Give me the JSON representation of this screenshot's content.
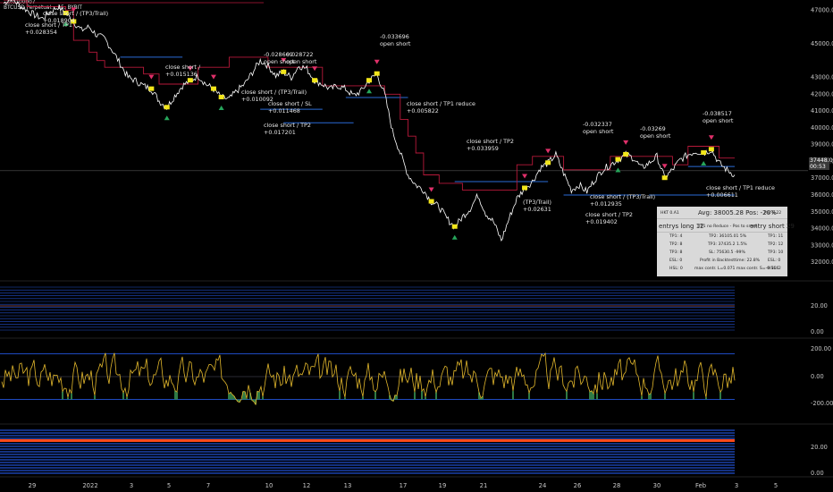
{
  "header": {
    "symbol": "BTCUSD Perpetual...",
    "interval": "15, BYBIT",
    "first_value": "-0.0100007"
  },
  "colors": {
    "background": "#000000",
    "price_line": "#ffffff",
    "stop_line": "#b7193a",
    "tp_line": "#2a6bd6",
    "buy_marker": "#26a65b",
    "sell_marker": "#e0306a",
    "fill_dot": "#f2e61a",
    "osc_line": "#e3b82c",
    "osc_fill": "#2f7a45",
    "band_blue": "#2962ff"
  },
  "price_axis": {
    "labels": [
      "47000.0",
      "45000.0",
      "43000.0",
      "42000.0",
      "41000.0",
      "40000.0",
      "39000.0",
      "38000.0",
      "37000.0",
      "36000.0",
      "35000.0",
      "34000.0",
      "33000.0",
      "32000.0"
    ],
    "current_price": "37448.0",
    "current_time": "00:53"
  },
  "panel2_axis": [
    "20.00",
    "0.00"
  ],
  "panel3_axis": [
    "200.00",
    "0.00",
    "-200.00"
  ],
  "panel4_axis": [
    "20.00",
    "0.00"
  ],
  "time_axis": [
    "29",
    "2022",
    "3",
    "5",
    "7",
    "10",
    "12",
    "13",
    "17",
    "19",
    "21",
    "24",
    "26",
    "28",
    "30",
    "Feb",
    "3",
    "5"
  ],
  "annotations": [
    {
      "lines": [
        "close short / (TP3/Trail)",
        "+0.018904"
      ]
    },
    {
      "lines": [
        "close short / TP1",
        "+0.028354"
      ]
    },
    {
      "lines": [
        "close short /",
        "+0.015136"
      ]
    },
    {
      "lines": [
        "-0.028669",
        "open short"
      ]
    },
    {
      "lines": [
        "0.028722",
        "open short"
      ]
    },
    {
      "lines": [
        "close short / (TP3/Trail)",
        "+0.010092"
      ]
    },
    {
      "lines": [
        "close short / SL",
        "+0.011468"
      ]
    },
    {
      "lines": [
        "close short / TP2",
        "+0.017201"
      ]
    },
    {
      "lines": [
        "-0.033696",
        "open short"
      ]
    },
    {
      "lines": [
        "close short / TP1 reduce",
        "+0.005822"
      ]
    },
    {
      "lines": [
        "close short / TP2",
        "+0.033959"
      ]
    },
    {
      "lines": [
        "(TP3/Trail)",
        "+0.02631"
      ]
    },
    {
      "lines": [
        "-0.032337",
        "open short"
      ]
    },
    {
      "lines": [
        "close short / (TP3/Trail)",
        "+0.012935"
      ]
    },
    {
      "lines": [
        "close short / TP2",
        "+0.019402"
      ]
    },
    {
      "lines": [
        "-0.03269",
        "open short"
      ]
    },
    {
      "lines": [
        "-0.038517",
        "open short"
      ]
    },
    {
      "lines": [
        "close short / TP1 reduce",
        "+0.006611"
      ]
    }
  ],
  "stats": {
    "hk_label": "HKT 0.A1",
    "avg_pos": "Avg: 38005.28 Pos: -20%",
    "pl": "P.V. 8.22",
    "entries_long": "entrys long 12",
    "tp1_reduce": "TP1 no Reduce - Pos to small",
    "entries_short": "entry short 29",
    "tp1_long": "TP1: 4",
    "tp2_mid": "TP2: 36105.01 5%",
    "tp1_short": "TP1: 11",
    "tp2_long": "TP2: 8",
    "tp3_mid": "TP3: 37435.2 1.5%",
    "tp2_short": "TP2: 12",
    "tp3_long": "TP3: 8",
    "sl_mid": "SL: 75630.5 -99%",
    "tp3_short": "TP3: 10",
    "esl_long": "ESL: 0",
    "profit_mid": "Profit in Backtesttime: 22.8%",
    "esl_short": "ESL: 0",
    "hsl_long": "HSL: 0",
    "max_contr": "max contr. L=0.071 max contr. S=-0.166",
    "hsl_short": "HSL: 2"
  },
  "chart_data": {
    "type": "line",
    "title": "",
    "xlabel": "",
    "ylabel": "",
    "x_ticks": [
      "29",
      "2022",
      "3",
      "5",
      "7",
      "10",
      "12",
      "13",
      "17",
      "19",
      "21",
      "24",
      "26",
      "28",
      "30",
      "Feb",
      "3",
      "5"
    ],
    "ylim": [
      31000,
      47600
    ],
    "series": [
      {
        "values": [
          47400,
          47700,
          47300,
          47000,
          46700,
          46500,
          46900,
          47200,
          46800,
          46300,
          45800,
          46000,
          45500,
          45300,
          44600,
          43800,
          43000,
          42800,
          42500,
          42300,
          41600,
          41200,
          41900,
          42500,
          42800,
          43100,
          42600,
          42300,
          41800,
          41700,
          42200,
          42600,
          43300,
          44000,
          43700,
          43100,
          43300,
          43000,
          43700,
          43500,
          42800,
          42600,
          42300,
          42500,
          42300,
          41900,
          42200,
          42800,
          43200,
          42000,
          39800,
          38500,
          37200,
          36600,
          36300,
          35600,
          35300,
          34600,
          34100,
          34700,
          35200,
          36000,
          34900,
          34400,
          33300,
          34600,
          35800,
          36400,
          36800,
          37600,
          37900,
          38400,
          37300,
          36300,
          36600,
          36200,
          36900,
          37500,
          37800,
          38100,
          38400,
          38200,
          37600,
          37900,
          38300,
          37000,
          37500,
          38100,
          38400,
          38600,
          38500,
          38700,
          37900,
          37500,
          37200
        ]
      }
    ],
    "stop_series": [
      47600,
      47600,
      47600,
      47200,
      47200,
      47200,
      47200,
      47200,
      47000,
      45200,
      45200,
      44500,
      44000,
      43600,
      43600,
      43600,
      43600,
      43600,
      43200,
      43200,
      42600,
      42600,
      42600,
      42600,
      42600,
      43600,
      43600,
      43600,
      43600,
      44200,
      44200,
      44200,
      44200,
      44200,
      43600,
      43600,
      43600,
      43600,
      43600,
      43600,
      43600,
      42500,
      42500,
      42500,
      42500,
      42500,
      42500,
      42500,
      42500,
      42000,
      42000,
      40500,
      39500,
      38500,
      37200,
      37200,
      36700,
      36700,
      36700,
      36300,
      36300,
      36300,
      36300,
      36300,
      36300,
      36300,
      37800,
      37800,
      38300,
      38300,
      38300,
      38300,
      37500,
      37500,
      37500,
      37500,
      37500,
      37500,
      38300,
      38300,
      38300,
      38300,
      38300,
      38300,
      38300,
      38300,
      37800,
      37800,
      38900,
      38900,
      38900,
      38900,
      38200,
      38200,
      38200
    ],
    "oscillator_range": [
      -250,
      250
    ]
  }
}
